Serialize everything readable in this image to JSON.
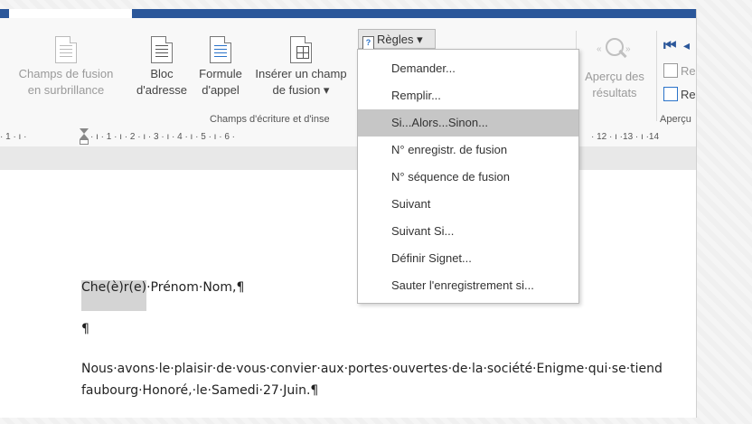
{
  "ribbon": {
    "btn_champs": [
      "Champs de fusion",
      "en surbrillance"
    ],
    "btn_bloc": [
      "Bloc",
      "d'adresse"
    ],
    "btn_formule": [
      "Formule",
      "d'appel"
    ],
    "btn_inserer": [
      "Insérer un champ",
      "de fusion ▾"
    ],
    "group_label": "Champs d'écriture et d'inse",
    "regles_label": "Règles ▾",
    "apercu": [
      "Aperçu des",
      "résultats"
    ],
    "apercu_group_label": "Aperçu",
    "small_re1": "Re",
    "small_re2": "Re"
  },
  "ruler": {
    "text_left": "· 1 · ı ·",
    "text_mid": "· ı · 1 · ı · 2 · ı · 3 · ı · 4 · ı · 5 · ı · 6 ·",
    "text_right": "· 12 · ı ·13 · ı ·14"
  },
  "menu": {
    "items": [
      "Demander...",
      "Remplir...",
      "Si...Alors...Sinon...",
      "N° enregistr. de fusion",
      "N° séquence de fusion",
      "Suivant",
      "Suivant Si...",
      "Définir Signet...",
      "Sauter l'enregistrement si..."
    ],
    "highlighted_index": 2
  },
  "document": {
    "field_text": "Che(è)r(e)",
    "line1_rest": "·Prénom·Nom,¶",
    "line2": "¶",
    "line3": "Nous·avons·le·plaisir·de·vous·convier·aux·portes·ouvertes·de·la·société·Enigme·qui·se·tiend",
    "line4": "faubourg·Honoré,·le·Samedi·27·Juin.¶"
  },
  "colors": {
    "accent": "#2b579a",
    "menu_highlight": "#c6c6c6",
    "field_shade": "#d4d4d4"
  }
}
